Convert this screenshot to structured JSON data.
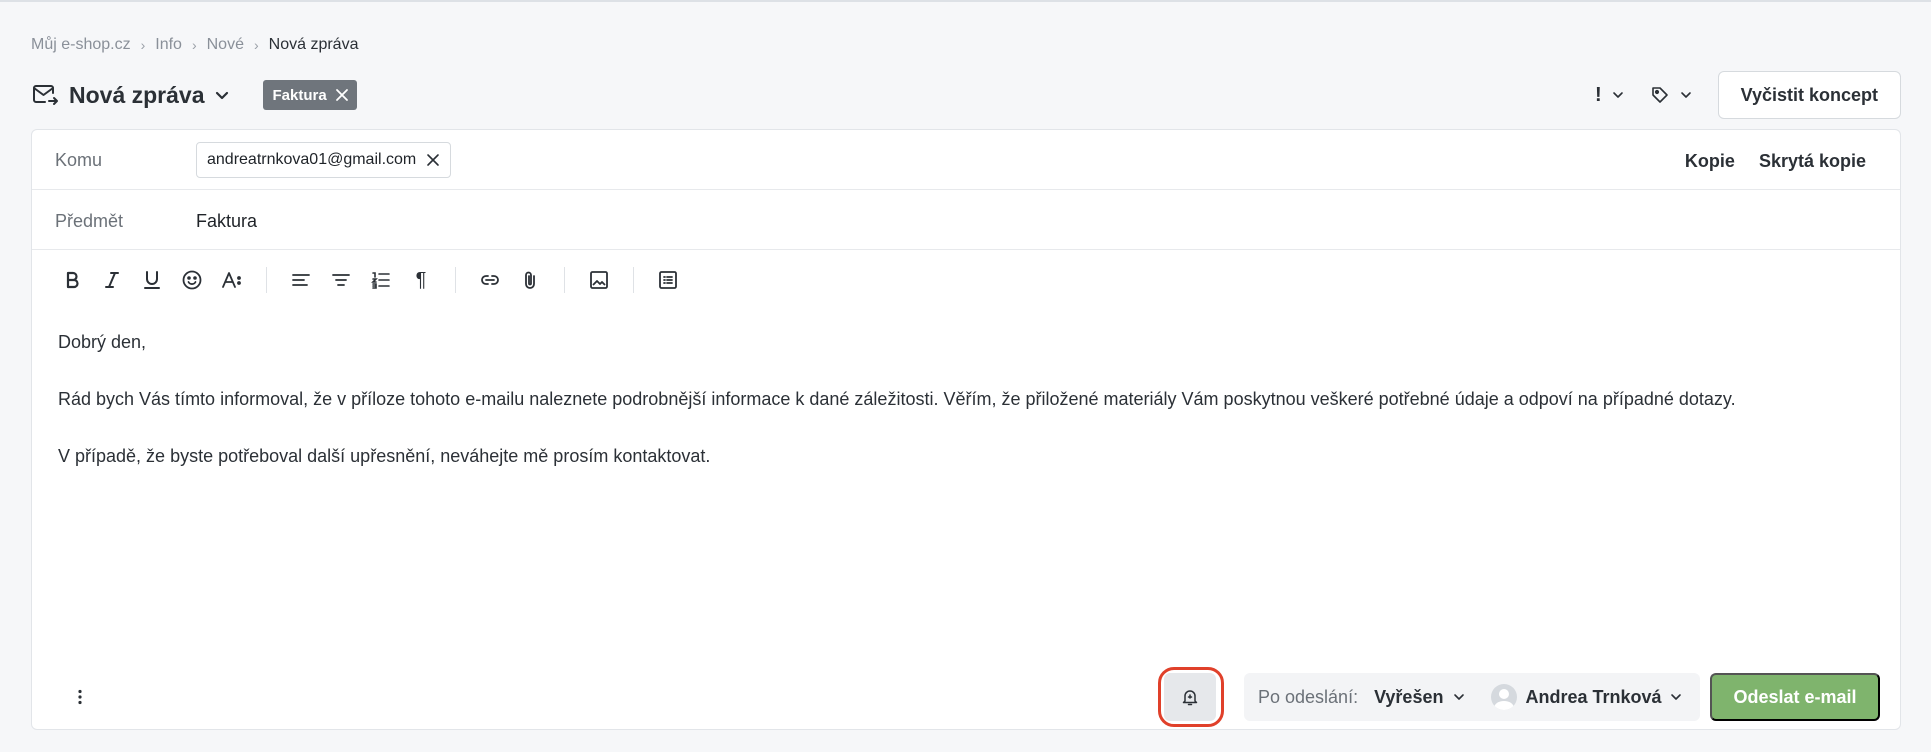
{
  "breadcrumb": {
    "items": [
      "Můj e-shop.cz",
      "Info",
      "Nové",
      "Nová zpráva"
    ],
    "separator": "›"
  },
  "header": {
    "title": "Nová zpráva",
    "tag": "Faktura",
    "priority_symbol": "!",
    "clear_draft_label": "Vyčistit koncept"
  },
  "compose": {
    "to_label": "Komu",
    "recipient": "andreatrnkova01@gmail.com",
    "cc_label": "Kopie",
    "bcc_label": "Skrytá kopie",
    "subject_label": "Předmět",
    "subject_value": "Faktura"
  },
  "toolbar": {
    "icons": [
      "bold-icon",
      "italic-icon",
      "underline-icon",
      "emoji-icon",
      "font-size-icon",
      "align-left-icon",
      "align-center-icon",
      "numbered-list-icon",
      "paragraph-icon",
      "link-icon",
      "attachment-icon",
      "image-icon",
      "template-icon"
    ]
  },
  "body": {
    "paragraphs": [
      "Dobrý den,",
      "Rád bych Vás tímto informoval, že v příloze tohoto e-mailu naleznete podrobnější informace k dané záležitosti. Věřím, že přiložené materiály Vám poskytnou veškeré potřebné údaje a odpoví na případné dotazy.",
      "V případě, že byste potřeboval další upřesnění, neváhejte mě prosím kontaktovat."
    ]
  },
  "footer": {
    "after_send_label": "Po odeslání:",
    "status_value": "Vyřešen",
    "assignee_name": "Andrea Trnková",
    "send_label": "Odeslat e-mail"
  },
  "colors": {
    "accent_send": "#7fb46d",
    "tag_bg": "#6f757c",
    "highlight": "#e0402a"
  }
}
